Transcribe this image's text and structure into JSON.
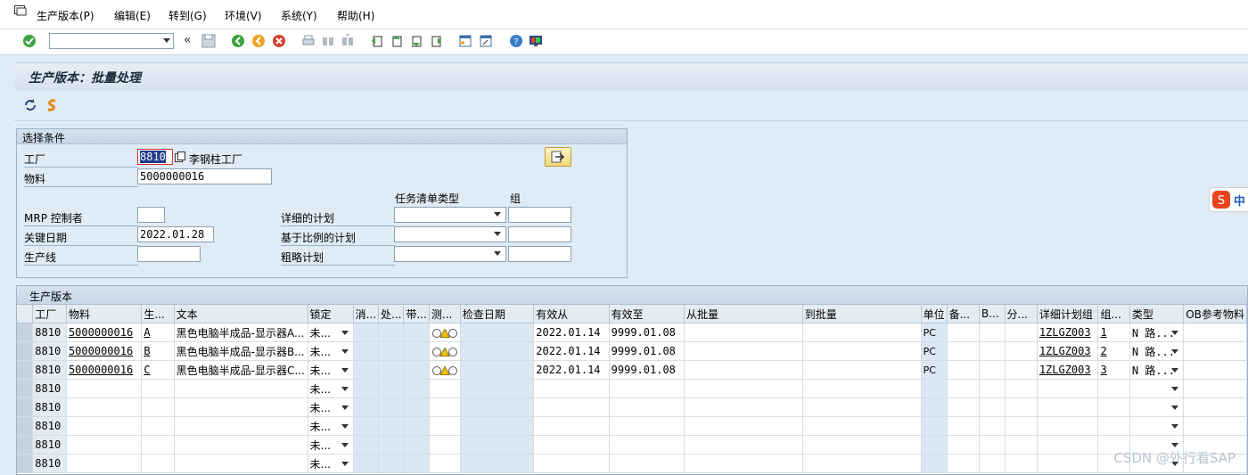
{
  "menu": {
    "items": [
      "生产版本(P)",
      "编辑(E)",
      "转到(G)",
      "环境(V)",
      "系统(Y)",
      "帮助(H)"
    ]
  },
  "toolbar": {
    "command_field_value": "",
    "collapse_glyph": "«"
  },
  "title": "生产版本：批量处理",
  "selection": {
    "header": "选择条件",
    "plant_label": "工厂",
    "plant_value": "8810",
    "plant_name": "李钢柱工厂",
    "material_label": "物料",
    "material_value": "5000000016",
    "tasklist_type_header": "任务清单类型",
    "group_header": "组",
    "mrp_label": "MRP 控制者",
    "mrp_value": "",
    "key_date_label": "关键日期",
    "key_date_value": "2022.01.28",
    "production_line_label": "生产线",
    "production_line_value": "",
    "detailed_plan_label": "详细的计划",
    "rate_plan_label": "基于比例的计划",
    "rough_plan_label": "粗略计划"
  },
  "table": {
    "header": "生产版本",
    "columns": [
      "工厂",
      "物料",
      "生...",
      "文本",
      "锁定",
      "消...",
      "处...",
      "带...",
      "测...",
      "检查日期",
      "有效从",
      "有效至",
      "从批量",
      "到批量",
      "单位",
      "备...",
      "B...",
      "分...",
      "详细计划组",
      "组...",
      "类型",
      "OB参考物料"
    ],
    "rows": [
      {
        "plant": "8810",
        "material": "5000000016",
        "version": "A",
        "text": "黑色电脑半成品-显示器A...",
        "lock": "未...",
        "check": "traffic",
        "valid_from": "2022.01.14",
        "valid_to": "9999.01.08",
        "unit": "PC",
        "plan_group": "1ZLGZ003",
        "group_counter": "1",
        "type": "N 路..."
      },
      {
        "plant": "8810",
        "material": "5000000016",
        "version": "B",
        "text": "黑色电脑半成品-显示器B...",
        "lock": "未...",
        "check": "traffic",
        "valid_from": "2022.01.14",
        "valid_to": "9999.01.08",
        "unit": "PC",
        "plan_group": "1ZLGZ003",
        "group_counter": "2",
        "type": "N 路..."
      },
      {
        "plant": "8810",
        "material": "5000000016",
        "version": "C",
        "text": "黑色电脑半成品-显示器C...",
        "lock": "未...",
        "check": "traffic",
        "valid_from": "2022.01.14",
        "valid_to": "9999.01.08",
        "unit": "PC",
        "plan_group": "1ZLGZ003",
        "group_counter": "3",
        "type": "N 路..."
      },
      {
        "plant": "8810",
        "material": "",
        "version": "",
        "text": "",
        "lock": "未...",
        "check": "",
        "valid_from": "",
        "valid_to": "",
        "unit": "",
        "plan_group": "",
        "group_counter": "",
        "type": ""
      },
      {
        "plant": "8810",
        "material": "",
        "version": "",
        "text": "",
        "lock": "未...",
        "check": "",
        "valid_from": "",
        "valid_to": "",
        "unit": "",
        "plan_group": "",
        "group_counter": "",
        "type": ""
      },
      {
        "plant": "8810",
        "material": "",
        "version": "",
        "text": "",
        "lock": "未...",
        "check": "",
        "valid_from": "",
        "valid_to": "",
        "unit": "",
        "plan_group": "",
        "group_counter": "",
        "type": ""
      },
      {
        "plant": "8810",
        "material": "",
        "version": "",
        "text": "",
        "lock": "未...",
        "check": "",
        "valid_from": "",
        "valid_to": "",
        "unit": "",
        "plan_group": "",
        "group_counter": "",
        "type": ""
      },
      {
        "plant": "8810",
        "material": "",
        "version": "",
        "text": "",
        "lock": "未...",
        "check": "",
        "valid_from": "",
        "valid_to": "",
        "unit": "",
        "plan_group": "",
        "group_counter": "",
        "type": ""
      }
    ]
  },
  "ime_label": "中",
  "watermark": "CSDN @外行看SAP",
  "colors": {
    "background": "#dfebf5",
    "accent_yellow": "#f3d877",
    "check_green": "#3ea33e",
    "cancel_red": "#d6402a"
  }
}
